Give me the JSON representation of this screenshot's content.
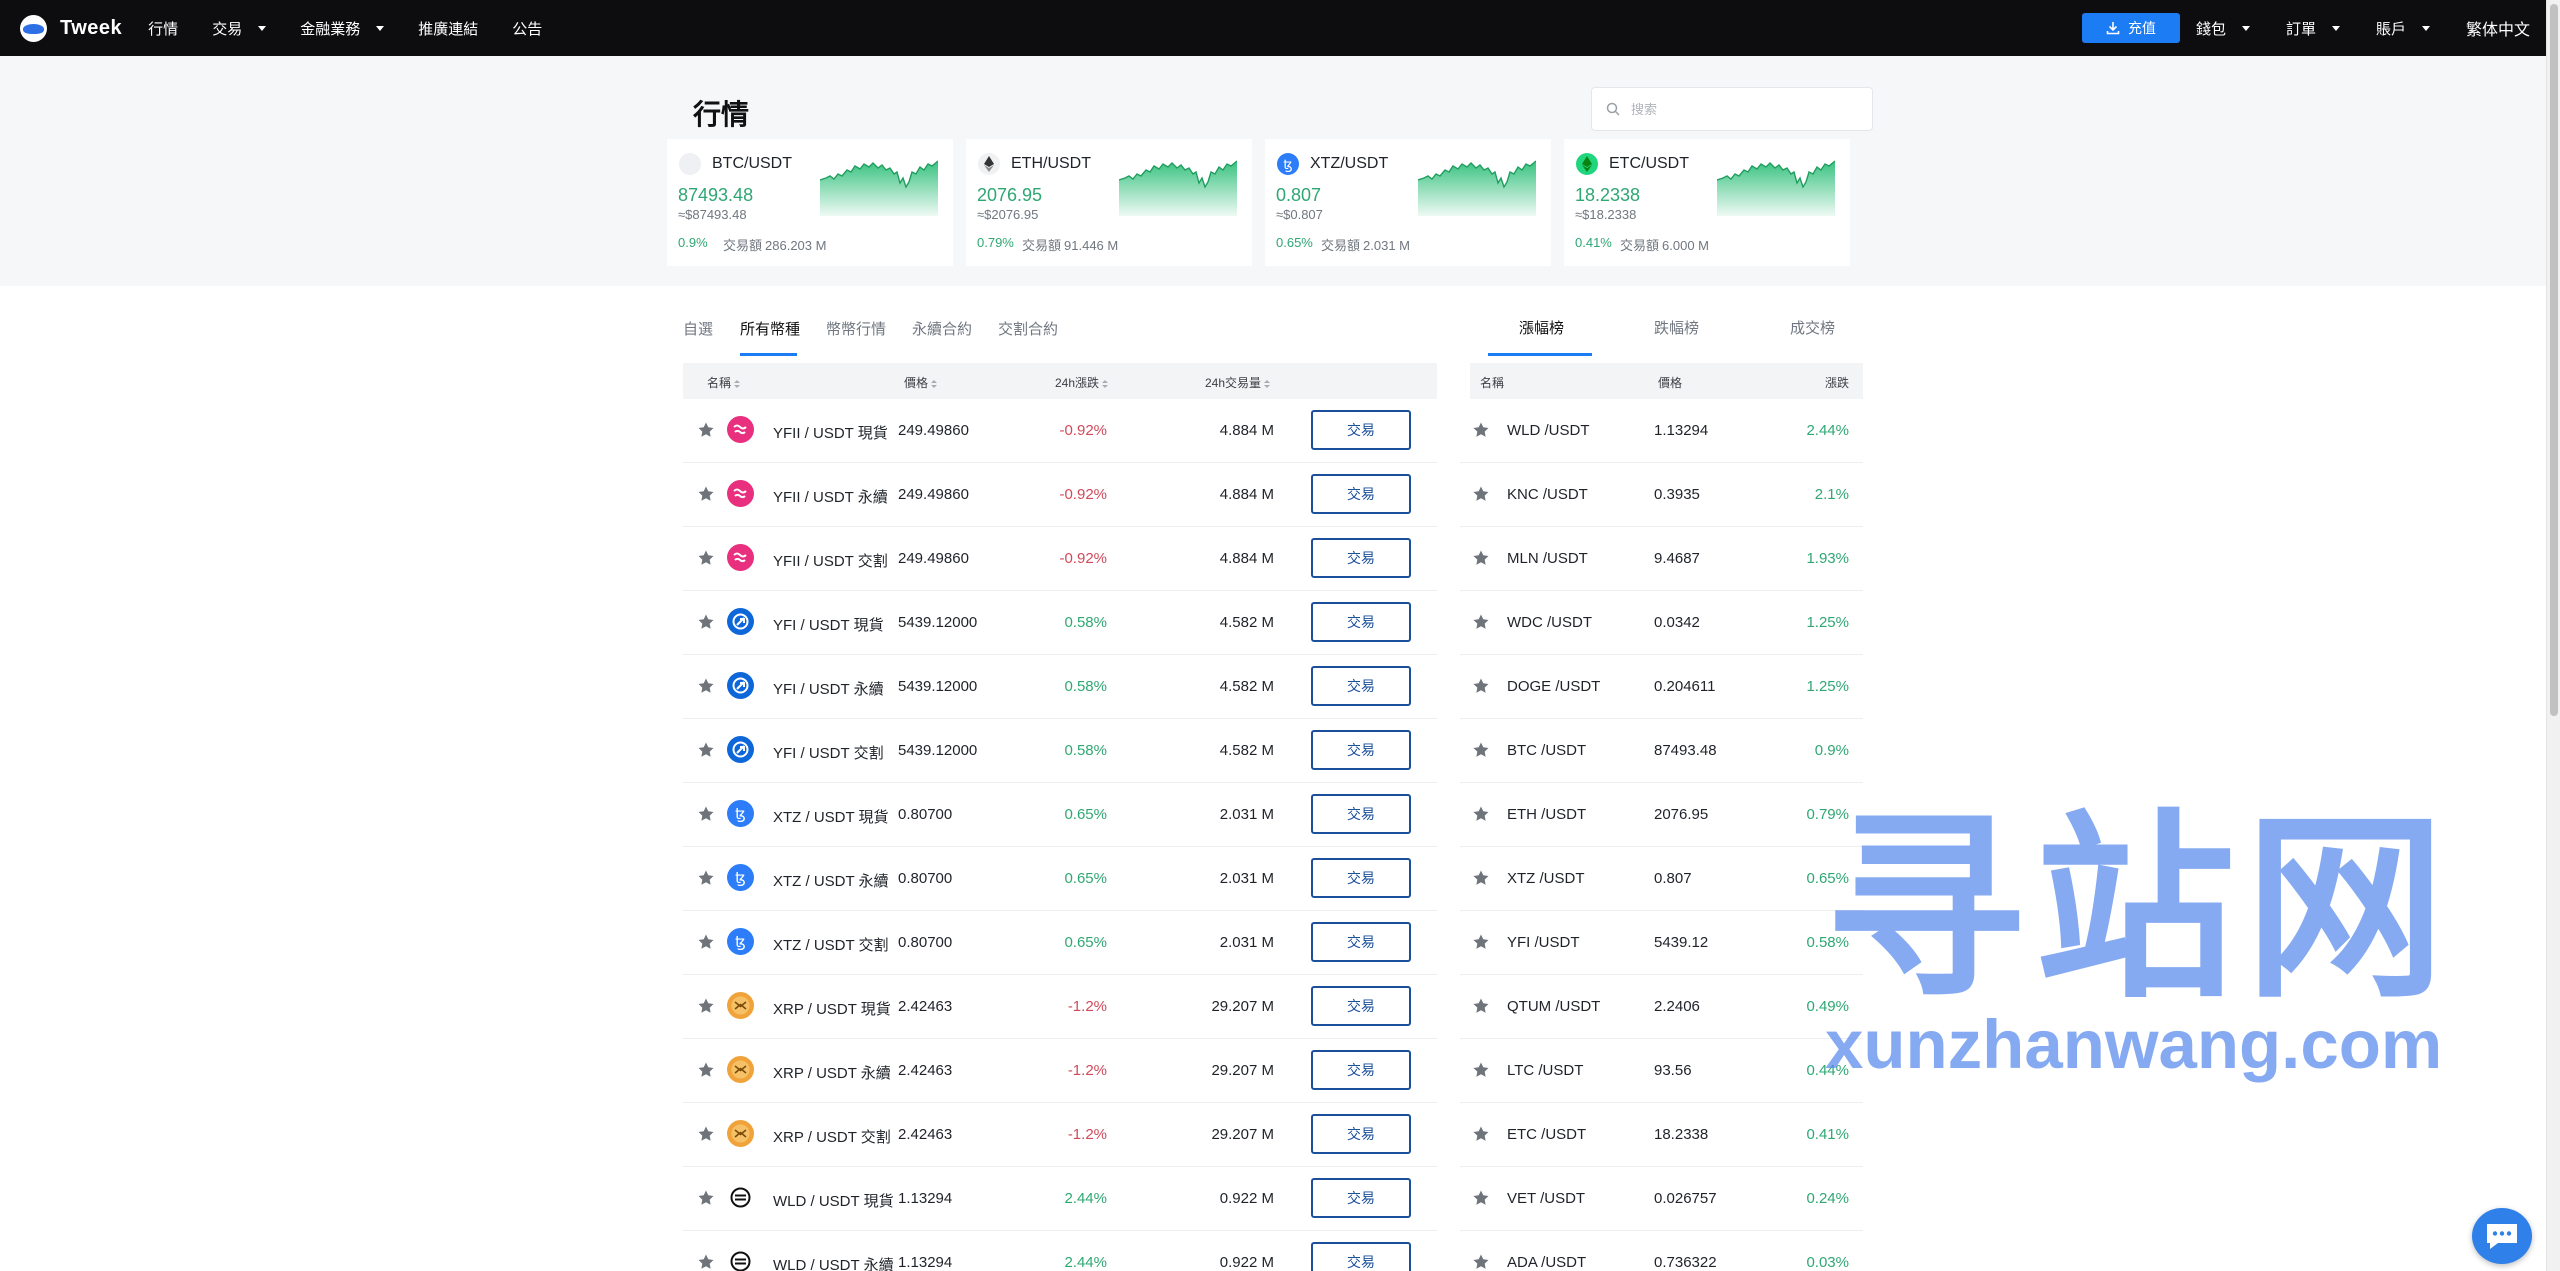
{
  "nav": {
    "brand": "Tweek",
    "items": [
      {
        "label": "行情",
        "caret": false
      },
      {
        "label": "交易",
        "caret": true
      },
      {
        "label": "金融業務",
        "caret": true
      },
      {
        "label": "推廣連結",
        "caret": false
      },
      {
        "label": "公告",
        "caret": false
      }
    ],
    "deposit": "充值",
    "right_items": [
      {
        "label": "錢包"
      },
      {
        "label": "訂單"
      },
      {
        "label": "賬戶"
      }
    ],
    "language": "繁体中文"
  },
  "hero": {
    "title": "行情",
    "search_placeholder": "搜索",
    "tickers": [
      {
        "pair": "BTC/USDT",
        "price": "87493.48",
        "usd": "≈$87493.48",
        "change": "0.9%",
        "volume_label": "交易額",
        "volume": "286.203 M",
        "icon": "btc-icon",
        "icon_color": "#eef0f3"
      },
      {
        "pair": "ETH/USDT",
        "price": "2076.95",
        "usd": "≈$2076.95",
        "change": "0.79%",
        "volume_label": "交易額",
        "volume": "91.446 M",
        "icon": "eth-icon",
        "icon_color": "#f0f1f3"
      },
      {
        "pair": "XTZ/USDT",
        "price": "0.807",
        "usd": "≈$0.807",
        "change": "0.65%",
        "volume_label": "交易額",
        "volume": "2.031 M",
        "icon": "xtz-icon",
        "icon_color": "#2c7df7"
      },
      {
        "pair": "ETC/USDT",
        "price": "18.2338",
        "usd": "≈$18.2338",
        "change": "0.41%",
        "volume_label": "交易額",
        "volume": "6.000 M",
        "icon": "etc-icon",
        "icon_color": "#1fd67e"
      }
    ]
  },
  "market": {
    "tabs": [
      "自選",
      "所有幣種",
      "幣幣行情",
      "永續合約",
      "交割合約"
    ],
    "active_tab": 1,
    "headers": {
      "name": "名稱",
      "price": "價格",
      "change": "24h漲跌",
      "volume": "24h交易量"
    },
    "trade_label": "交易",
    "rows": [
      {
        "name": "YFII / USDT 現貨",
        "price": "249.49860",
        "change": "-0.92%",
        "direction": "down",
        "volume": "4.884 M",
        "icon": "yfii-icon",
        "color": "#e8307f"
      },
      {
        "name": "YFII / USDT 永續",
        "price": "249.49860",
        "change": "-0.92%",
        "direction": "down",
        "volume": "4.884 M",
        "icon": "yfii-icon",
        "color": "#e8307f"
      },
      {
        "name": "YFII / USDT 交割",
        "price": "249.49860",
        "change": "-0.92%",
        "direction": "down",
        "volume": "4.884 M",
        "icon": "yfii-icon",
        "color": "#e8307f"
      },
      {
        "name": "YFI / USDT 現貨",
        "price": "5439.12000",
        "change": "0.58%",
        "direction": "up",
        "volume": "4.582 M",
        "icon": "yfi-icon",
        "color": "#0e67d8"
      },
      {
        "name": "YFI / USDT 永續",
        "price": "5439.12000",
        "change": "0.58%",
        "direction": "up",
        "volume": "4.582 M",
        "icon": "yfi-icon",
        "color": "#0e67d8"
      },
      {
        "name": "YFI / USDT 交割",
        "price": "5439.12000",
        "change": "0.58%",
        "direction": "up",
        "volume": "4.582 M",
        "icon": "yfi-icon",
        "color": "#0e67d8"
      },
      {
        "name": "XTZ / USDT 現貨",
        "price": "0.80700",
        "change": "0.65%",
        "direction": "up",
        "volume": "2.031 M",
        "icon": "xtz-icon",
        "color": "#2c7df7"
      },
      {
        "name": "XTZ / USDT 永續",
        "price": "0.80700",
        "change": "0.65%",
        "direction": "up",
        "volume": "2.031 M",
        "icon": "xtz-icon",
        "color": "#2c7df7"
      },
      {
        "name": "XTZ / USDT 交割",
        "price": "0.80700",
        "change": "0.65%",
        "direction": "up",
        "volume": "2.031 M",
        "icon": "xtz-icon",
        "color": "#2c7df7"
      },
      {
        "name": "XRP / USDT 現貨",
        "price": "2.42463",
        "change": "-1.2%",
        "direction": "down",
        "volume": "29.207 M",
        "icon": "xrp-icon",
        "color": "#f1a33b"
      },
      {
        "name": "XRP / USDT 永續",
        "price": "2.42463",
        "change": "-1.2%",
        "direction": "down",
        "volume": "29.207 M",
        "icon": "xrp-icon",
        "color": "#f1a33b"
      },
      {
        "name": "XRP / USDT 交割",
        "price": "2.42463",
        "change": "-1.2%",
        "direction": "down",
        "volume": "29.207 M",
        "icon": "xrp-icon",
        "color": "#f1a33b"
      },
      {
        "name": "WLD / USDT 現貨",
        "price": "1.13294",
        "change": "2.44%",
        "direction": "up",
        "volume": "0.922 M",
        "icon": "wld-icon",
        "color": "#ffffff"
      },
      {
        "name": "WLD / USDT 永續",
        "price": "1.13294",
        "change": "2.44%",
        "direction": "up",
        "volume": "0.922 M",
        "icon": "wld-icon",
        "color": "#ffffff"
      }
    ]
  },
  "ranking": {
    "tabs": [
      "漲幅榜",
      "跌幅榜",
      "成交榜"
    ],
    "active_tab": 0,
    "headers": {
      "name": "名稱",
      "price": "價格",
      "change": "漲跌"
    },
    "rows": [
      {
        "name": "WLD /USDT",
        "price": "1.13294",
        "change": "2.44%"
      },
      {
        "name": "KNC /USDT",
        "price": "0.3935",
        "change": "2.1%"
      },
      {
        "name": "MLN /USDT",
        "price": "9.4687",
        "change": "1.93%"
      },
      {
        "name": "WDC /USDT",
        "price": "0.0342",
        "change": "1.25%"
      },
      {
        "name": "DOGE /USDT",
        "price": "0.204611",
        "change": "1.25%"
      },
      {
        "name": "BTC /USDT",
        "price": "87493.48",
        "change": "0.9%"
      },
      {
        "name": "ETH /USDT",
        "price": "2076.95",
        "change": "0.79%"
      },
      {
        "name": "XTZ /USDT",
        "price": "0.807",
        "change": "0.65%"
      },
      {
        "name": "YFI /USDT",
        "price": "5439.12",
        "change": "0.58%"
      },
      {
        "name": "QTUM /USDT",
        "price": "2.2406",
        "change": "0.49%"
      },
      {
        "name": "LTC /USDT",
        "price": "93.56",
        "change": "0.44%"
      },
      {
        "name": "ETC /USDT",
        "price": "18.2338",
        "change": "0.41%"
      },
      {
        "name": "VET /USDT",
        "price": "0.026757",
        "change": "0.24%"
      },
      {
        "name": "ADA /USDT",
        "price": "0.736322",
        "change": "0.03%"
      }
    ]
  },
  "watermark": {
    "cn": "寻站网",
    "en": "xunzhanwang.com"
  },
  "colors": {
    "up": "#2fa773",
    "down": "#d24a5a",
    "accent": "#1c7cf4",
    "trade_border": "#1a4f9c"
  }
}
